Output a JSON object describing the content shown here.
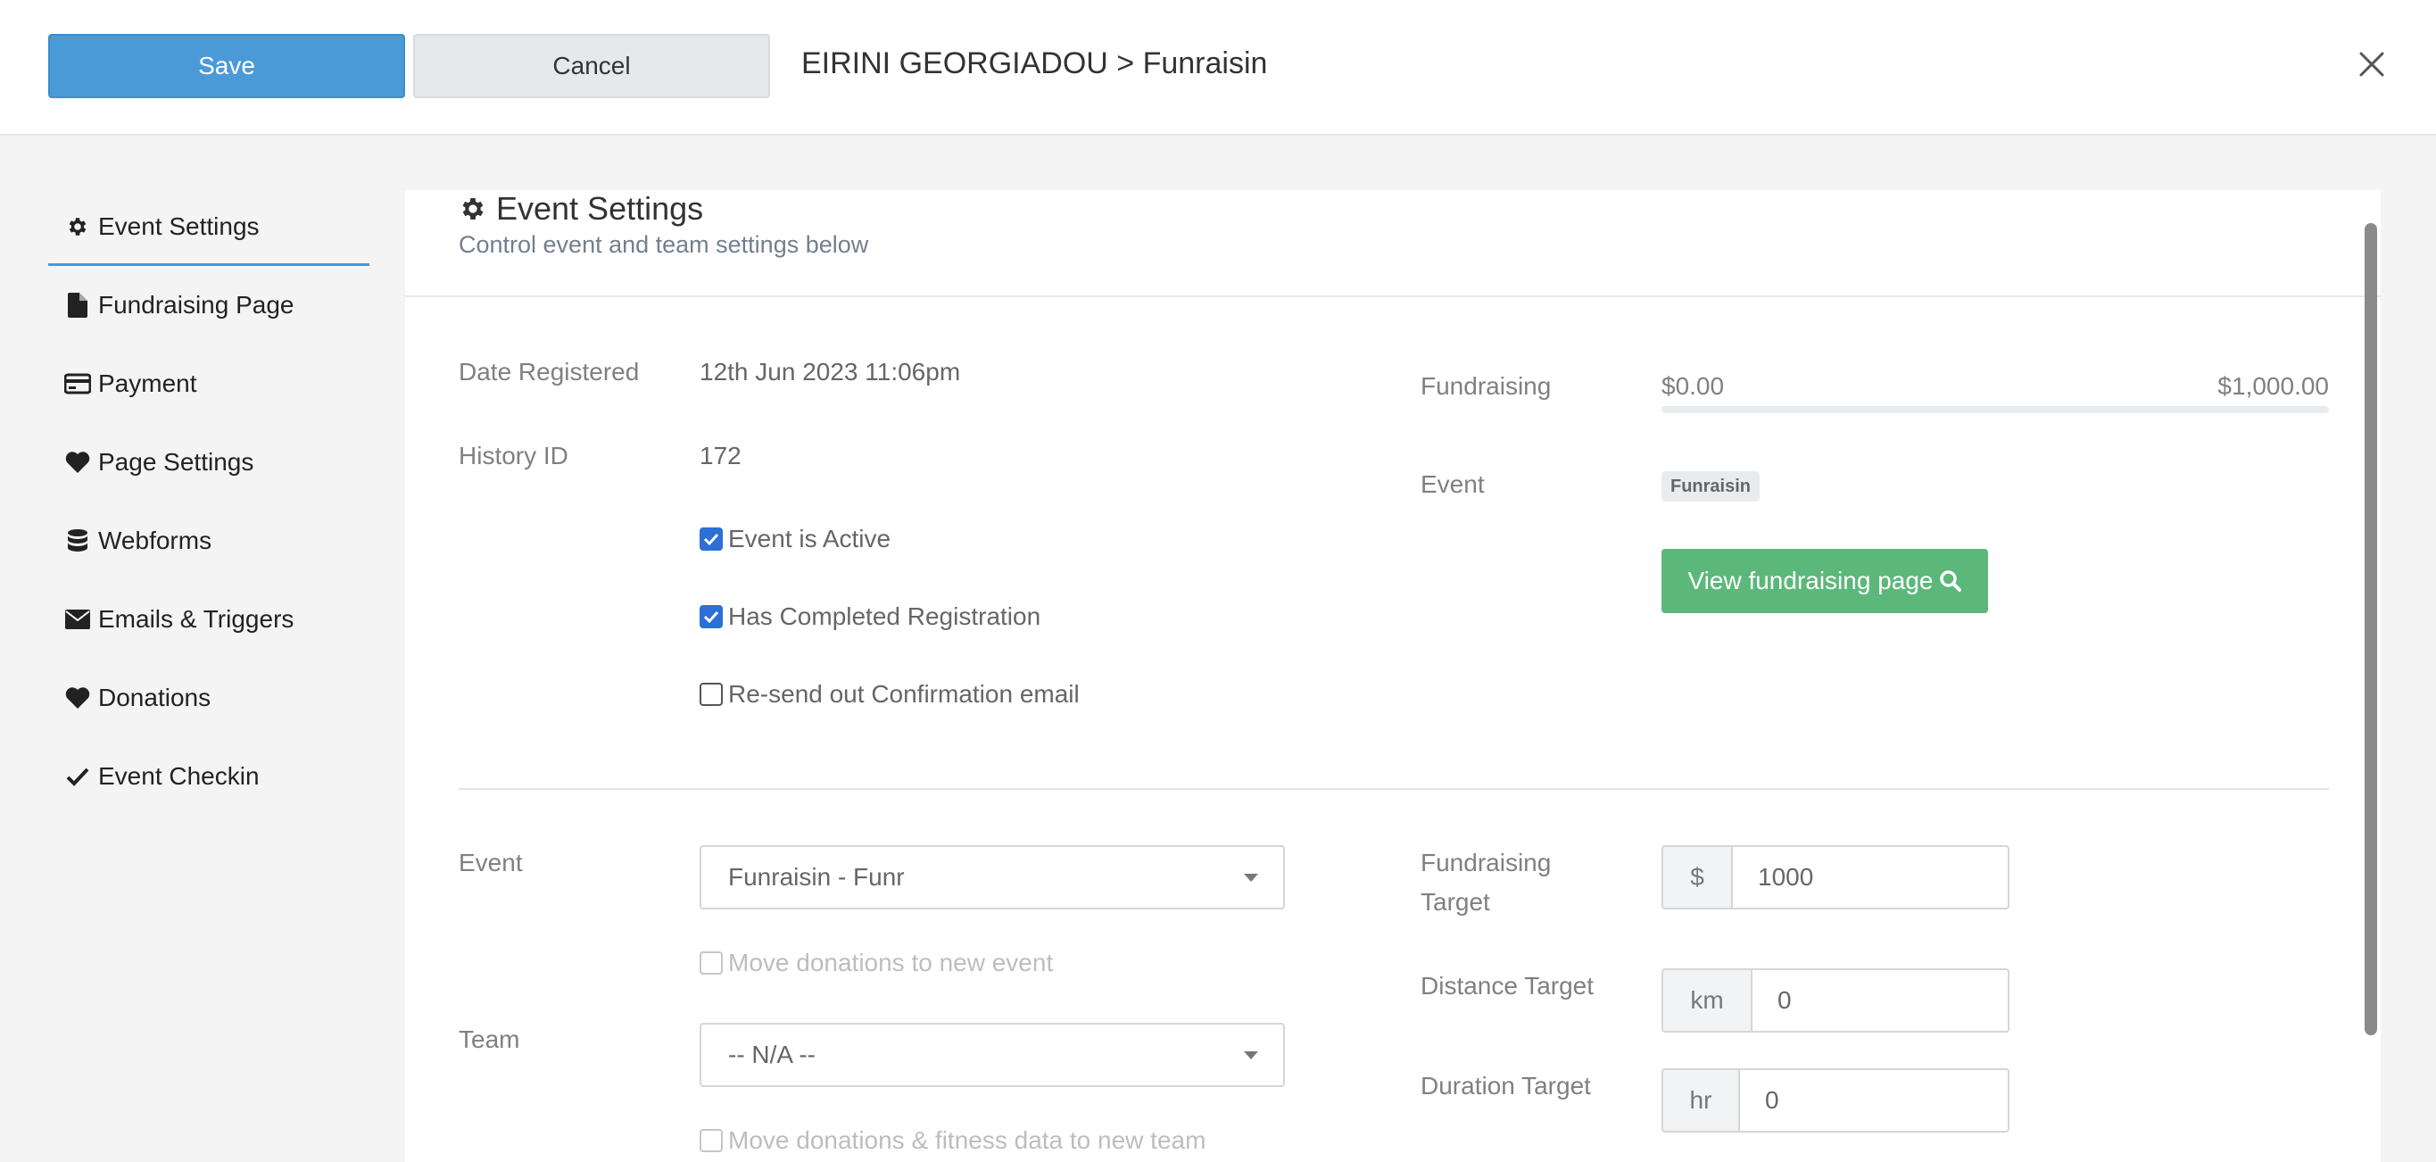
{
  "header": {
    "save_label": "Save",
    "cancel_label": "Cancel",
    "title": "EIRINI GEORGIADOU > Funraisin"
  },
  "sidebar": {
    "items": [
      {
        "label": "Event Settings",
        "icon": "gear-icon",
        "active": true
      },
      {
        "label": "Fundraising Page",
        "icon": "file-icon"
      },
      {
        "label": "Payment",
        "icon": "credit-card-icon"
      },
      {
        "label": "Page Settings",
        "icon": "heart-icon"
      },
      {
        "label": "Webforms",
        "icon": "database-icon"
      },
      {
        "label": "Emails & Triggers",
        "icon": "envelope-icon"
      },
      {
        "label": "Donations",
        "icon": "heart-icon"
      },
      {
        "label": "Event Checkin",
        "icon": "check-icon"
      }
    ]
  },
  "main": {
    "title": "Event Settings",
    "subtitle": "Control event and team settings below",
    "date_registered_label": "Date Registered",
    "date_registered_value": "12th Jun 2023 11:06pm",
    "history_id_label": "History ID",
    "history_id_value": "172",
    "checkboxes": {
      "event_active": {
        "label": "Event is Active",
        "checked": true
      },
      "completed_registration": {
        "label": "Has Completed Registration",
        "checked": true
      },
      "resend_confirmation": {
        "label": "Re-send out Confirmation email",
        "checked": false
      }
    },
    "fundraising_label": "Fundraising",
    "fundraising_raised": "$0.00",
    "fundraising_target_display": "$1,000.00",
    "fundraising_progress": 0,
    "event_label": "Event",
    "event_badge": "Funraisin",
    "view_page_label": "View fundraising page",
    "event_select_label": "Event",
    "event_select_value": "Funraisin - Funr",
    "move_donations_label": "Move donations to new event",
    "team_label": "Team",
    "team_select_value": "-- N/A --",
    "move_team_label": "Move donations & fitness data to new team",
    "fundraising_target_label_1": "Fundraising",
    "fundraising_target_label_2": "Target",
    "fundraising_target_addon": "$",
    "fundraising_target_value": "1000",
    "distance_target_label": "Distance Target",
    "distance_target_addon": "km",
    "distance_target_value": "0",
    "duration_target_label": "Duration Target",
    "duration_target_addon": "hr",
    "duration_target_value": "0"
  },
  "colors": {
    "primary": "#4a9ad8",
    "success": "#5cb87a",
    "checkbox": "#2c6fd6"
  }
}
